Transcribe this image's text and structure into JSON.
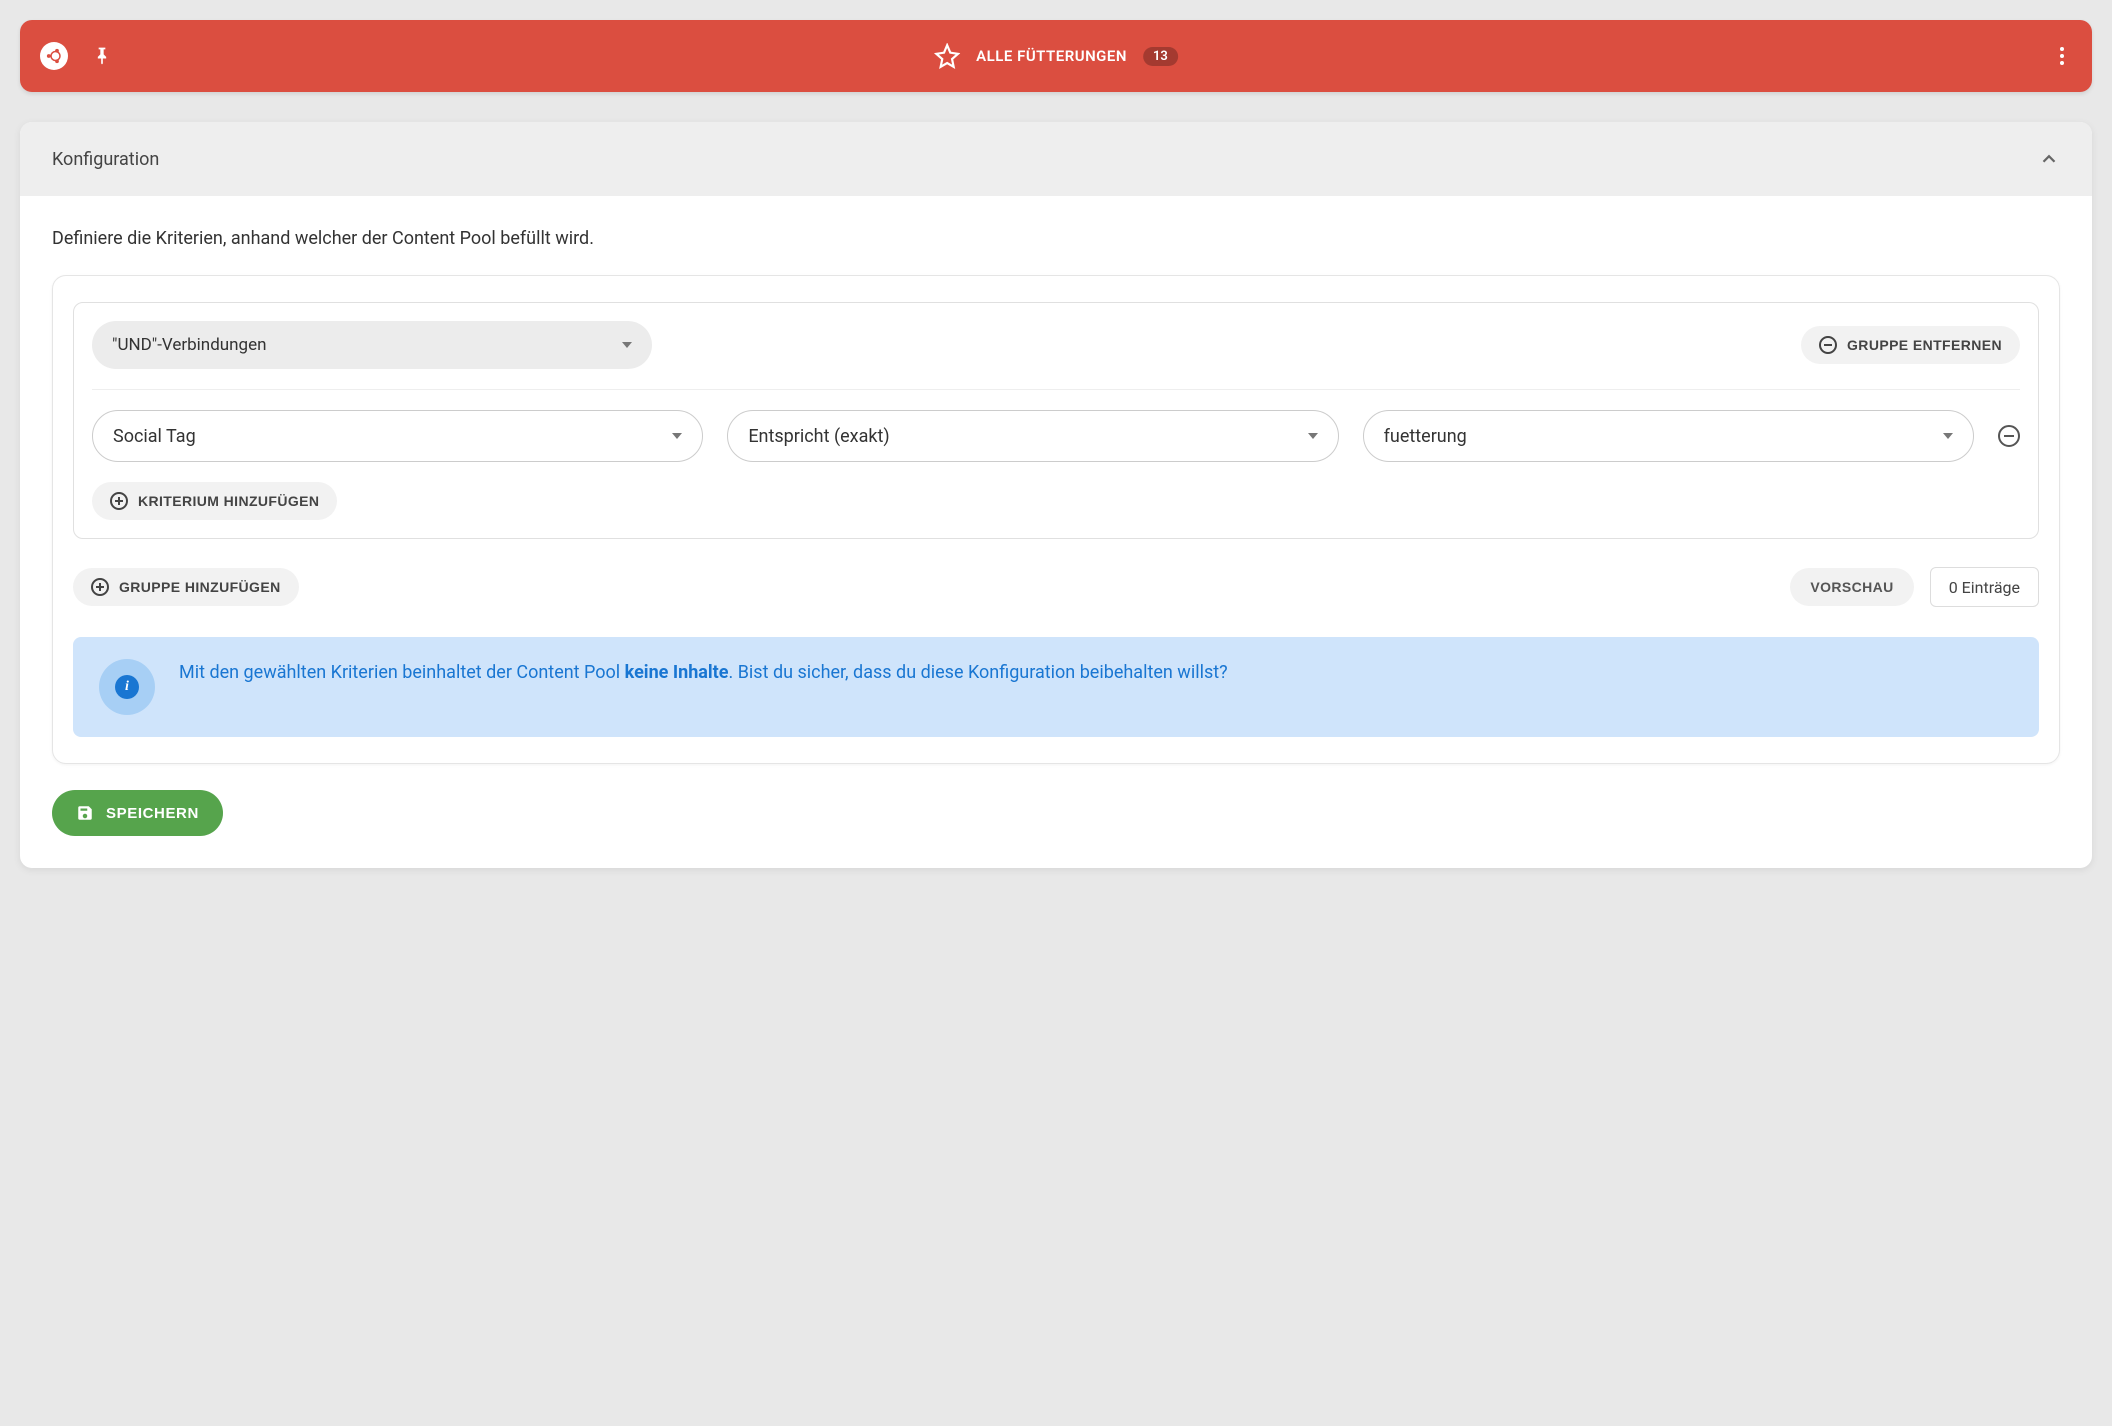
{
  "header": {
    "title": "ALLE FÜTTERUNGEN",
    "badge": "13"
  },
  "config": {
    "section_title": "Konfiguration",
    "instruction": "Definiere die Kriterien, anhand welcher der Content Pool befüllt wird.",
    "connector_value": "\"UND\"-Verbindungen",
    "remove_group_label": "GRUPPE ENTFERNEN",
    "criteria": {
      "field": "Social Tag",
      "operator": "Entspricht (exakt)",
      "value": "fuetterung"
    },
    "add_criterion_label": "KRITERIUM HINZUFÜGEN",
    "add_group_label": "GRUPPE HINZUFÜGEN",
    "preview_label": "VORSCHAU",
    "entries_text": "0 Einträge",
    "alert": {
      "pre": "Mit den gewählten Kriterien beinhaltet der Content Pool ",
      "bold": "keine Inhalte",
      "post": ". Bist du sicher, dass du diese Konfiguration beibehalten willst?"
    },
    "save_label": "SPEICHERN"
  }
}
